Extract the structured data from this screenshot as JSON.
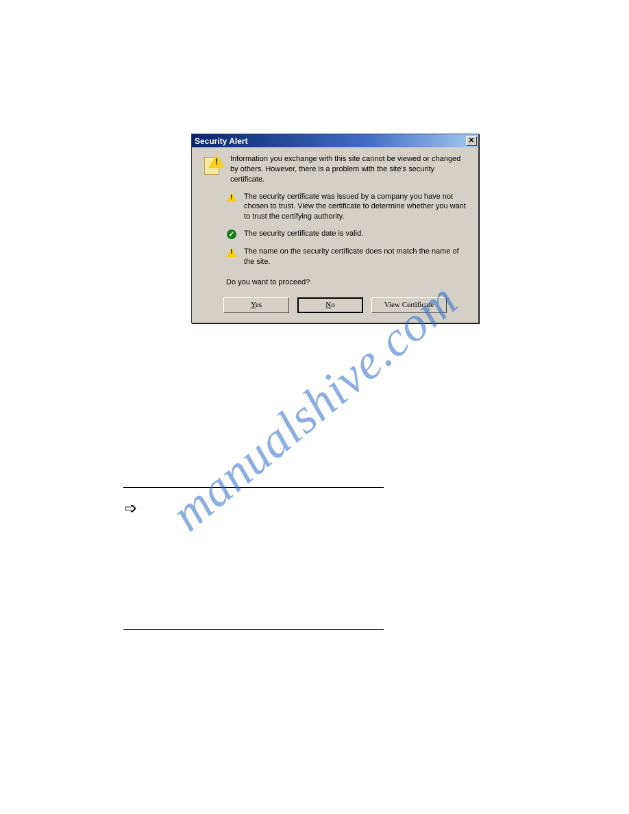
{
  "dialog": {
    "title": "Security Alert",
    "intro": "Information you exchange with this site cannot be viewed or changed by others. However, there is a problem with the site's security certificate.",
    "items": [
      {
        "status": "warn",
        "text": "The security certificate was issued by a company you have not chosen to trust. View the certificate to determine whether you want to trust the certifying authority."
      },
      {
        "status": "ok",
        "text": "The security certificate date is valid."
      },
      {
        "status": "warn",
        "text": "The name on the security certificate does not match the name of the site."
      }
    ],
    "prompt": "Do you want to proceed?",
    "buttons": {
      "yes": "Yes",
      "no": "No",
      "view": "View Certificate"
    }
  },
  "watermark": "manualshive.com"
}
